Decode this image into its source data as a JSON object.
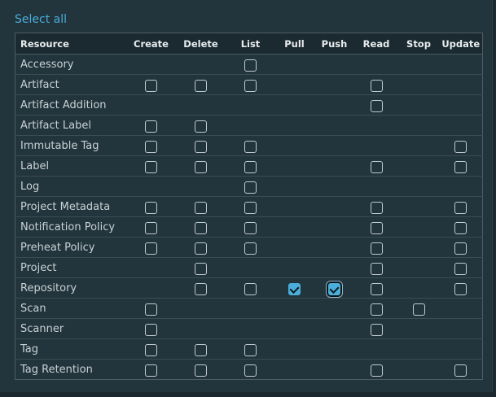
{
  "select_all_label": "Select all",
  "columns": [
    "Resource",
    "Create",
    "Delete",
    "List",
    "Pull",
    "Push",
    "Read",
    "Stop",
    "Update"
  ],
  "checkbox_states": {
    "none": "absent",
    "off": "unchecked",
    "on": "checked"
  },
  "rows": [
    {
      "name": "Accessory",
      "cells": [
        "none",
        "none",
        "off",
        "none",
        "none",
        "none",
        "none",
        "none"
      ]
    },
    {
      "name": "Artifact",
      "cells": [
        "off",
        "off",
        "off",
        "none",
        "none",
        "off",
        "none",
        "none"
      ]
    },
    {
      "name": "Artifact Addition",
      "cells": [
        "none",
        "none",
        "none",
        "none",
        "none",
        "off",
        "none",
        "none"
      ]
    },
    {
      "name": "Artifact Label",
      "cells": [
        "off",
        "off",
        "none",
        "none",
        "none",
        "none",
        "none",
        "none"
      ]
    },
    {
      "name": "Immutable Tag",
      "cells": [
        "off",
        "off",
        "off",
        "none",
        "none",
        "none",
        "none",
        "off"
      ]
    },
    {
      "name": "Label",
      "cells": [
        "off",
        "off",
        "off",
        "none",
        "none",
        "off",
        "none",
        "off"
      ]
    },
    {
      "name": "Log",
      "cells": [
        "none",
        "none",
        "off",
        "none",
        "none",
        "none",
        "none",
        "none"
      ]
    },
    {
      "name": "Project Metadata",
      "cells": [
        "off",
        "off",
        "off",
        "none",
        "none",
        "off",
        "none",
        "off"
      ]
    },
    {
      "name": "Notification Policy",
      "cells": [
        "off",
        "off",
        "off",
        "none",
        "none",
        "off",
        "none",
        "off"
      ]
    },
    {
      "name": "Preheat Policy",
      "cells": [
        "off",
        "off",
        "off",
        "none",
        "none",
        "off",
        "none",
        "off"
      ]
    },
    {
      "name": "Project",
      "cells": [
        "none",
        "off",
        "none",
        "none",
        "none",
        "off",
        "none",
        "off"
      ]
    },
    {
      "name": "Repository",
      "cells": [
        "none",
        "off",
        "off",
        "on",
        "on",
        "off",
        "none",
        "off"
      ]
    },
    {
      "name": "Scan",
      "cells": [
        "off",
        "none",
        "none",
        "none",
        "none",
        "off",
        "off",
        "none"
      ]
    },
    {
      "name": "Scanner",
      "cells": [
        "off",
        "none",
        "none",
        "none",
        "none",
        "off",
        "none",
        "none"
      ]
    },
    {
      "name": "Tag",
      "cells": [
        "off",
        "off",
        "off",
        "none",
        "none",
        "none",
        "none",
        "none"
      ]
    },
    {
      "name": "Tag Retention",
      "cells": [
        "off",
        "off",
        "off",
        "none",
        "none",
        "off",
        "none",
        "off"
      ]
    }
  ],
  "focused_cell": {
    "row": "Repository",
    "column": "Push"
  },
  "colors": {
    "accent": "#4aaed9",
    "background": "#22343c",
    "header_bg": "#1b2a30"
  }
}
